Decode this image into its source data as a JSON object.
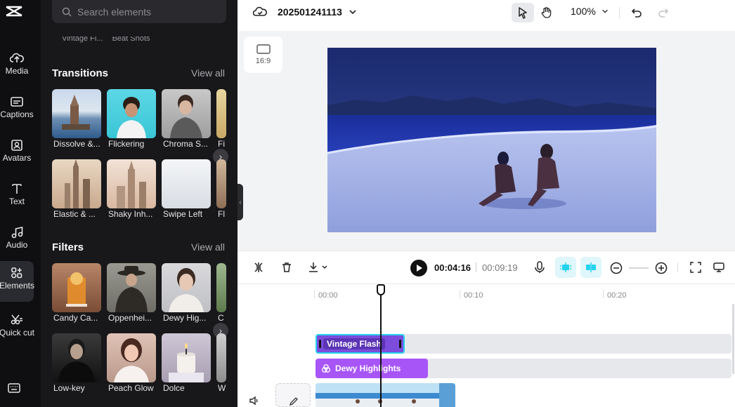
{
  "app": {
    "project_title": "202501241113",
    "zoom_level": "100%",
    "aspect_ratio": "16:9"
  },
  "rail": {
    "items": [
      {
        "label": "Media",
        "icon": "cloud-upload-icon"
      },
      {
        "label": "Captions",
        "icon": "captions-icon"
      },
      {
        "label": "Avatars",
        "icon": "avatar-icon"
      },
      {
        "label": "Text",
        "icon": "text-icon"
      },
      {
        "label": "Audio",
        "icon": "music-note-icon"
      },
      {
        "label": "Elements",
        "icon": "elements-icon"
      },
      {
        "label": "Quick cut",
        "icon": "quick-cut-icon"
      }
    ]
  },
  "panel": {
    "search_placeholder": "Search elements",
    "prev_row": [
      "Vintage Fl...",
      "Beat Shots"
    ],
    "transitions": {
      "title": "Transitions",
      "view_all": "View all",
      "items": [
        "Dissolve &...",
        "Flickering",
        "Chroma S...",
        "Fi",
        "Elastic & ...",
        "Shaky Inh...",
        "Swipe Left",
        "Fl"
      ]
    },
    "filters": {
      "title": "Filters",
      "view_all": "View all",
      "items": [
        "Candy Ca...",
        "Oppenhei...",
        "Dewy Hig...",
        "C",
        "Low-key",
        "Peach Glow",
        "Dolce",
        "W"
      ]
    }
  },
  "timeline": {
    "current_time": "00:04:16",
    "total_time": "00:09:19",
    "ruler": [
      "00:00",
      "00:10",
      "00:20"
    ],
    "clips": {
      "effect": "Vintage Flash",
      "filter": "Dewy Highlights"
    }
  },
  "colors": {
    "accent_cyan": "#22d3ee",
    "effect_clip": "#7c4ddc",
    "filter_clip": "#a855f7"
  }
}
